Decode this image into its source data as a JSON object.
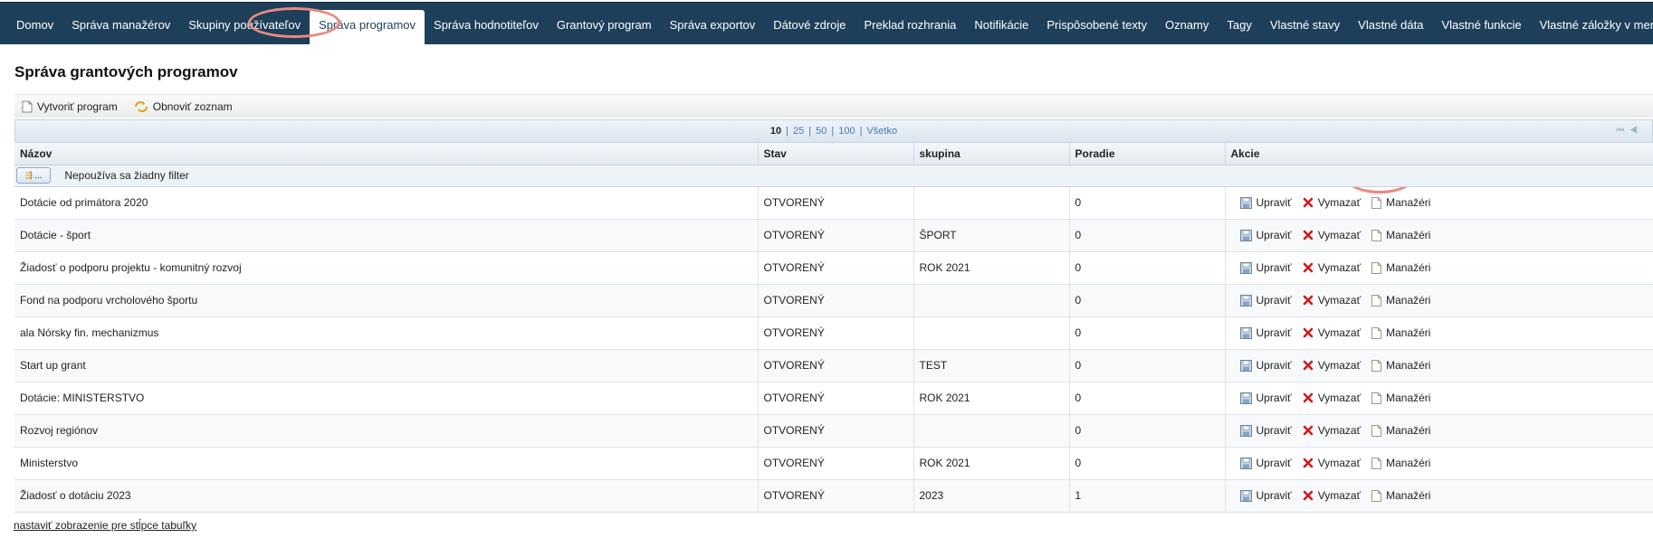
{
  "nav": {
    "items": [
      {
        "label": "Domov"
      },
      {
        "label": "Správa manažérov"
      },
      {
        "label": "Skupiny používateľov"
      },
      {
        "label": "Správa programov"
      },
      {
        "label": "Správa hodnotiteľov"
      },
      {
        "label": "Grantový program"
      },
      {
        "label": "Správa exportov"
      },
      {
        "label": "Dátové zdroje"
      },
      {
        "label": "Preklad rozhrania"
      },
      {
        "label": "Notifikácie"
      },
      {
        "label": "Prispôsobené texty"
      },
      {
        "label": "Oznamy"
      },
      {
        "label": "Tagy"
      },
      {
        "label": "Vlastné stavy"
      },
      {
        "label": "Vlastné dáta"
      },
      {
        "label": "Vlastné funkcie"
      },
      {
        "label": "Vlastné záložky v menu"
      }
    ],
    "active_index": 3
  },
  "page": {
    "title": "Správa grantových programov"
  },
  "toolbar": {
    "create_label": "Vytvoriť program",
    "refresh_label": "Obnoviť zoznam"
  },
  "pager": {
    "sizes": [
      "10",
      "25",
      "50",
      "100",
      "Všetko"
    ],
    "current": "10"
  },
  "table": {
    "headers": {
      "name": "Názov",
      "status": "Stav",
      "group": "skupina",
      "order": "Poradie",
      "actions": "Akcie"
    },
    "filter": {
      "button_label": "...",
      "text": "Nepoužíva sa žiadny filter"
    },
    "action_labels": {
      "edit": "Upraviť",
      "delete": "Vymazať",
      "managers": "Manažéri"
    },
    "rows": [
      {
        "name": "Dotácie od primátora 2020",
        "status": "OTVORENÝ",
        "group": "",
        "order": "0"
      },
      {
        "name": "Dotácie - šport",
        "status": "OTVORENÝ",
        "group": "ŠPORT",
        "order": "0"
      },
      {
        "name": "Žiadosť o podporu projektu - komunitný rozvoj",
        "status": "OTVORENÝ",
        "group": "ROK 2021",
        "order": "0"
      },
      {
        "name": "Fond na podporu vrcholového športu",
        "status": "OTVORENÝ",
        "group": "",
        "order": "0"
      },
      {
        "name": "ala Nórsky fin. mechanizmus",
        "status": "OTVORENÝ",
        "group": "",
        "order": "0"
      },
      {
        "name": "Start up grant",
        "status": "OTVORENÝ",
        "group": "TEST",
        "order": "0"
      },
      {
        "name": "Dotácie: MINISTERSTVO",
        "status": "OTVORENÝ",
        "group": "ROK 2021",
        "order": "0"
      },
      {
        "name": "Rozvoj regiónov",
        "status": "OTVORENÝ",
        "group": "",
        "order": "0"
      },
      {
        "name": "Ministerstvo",
        "status": "OTVORENÝ",
        "group": "ROK 2021",
        "order": "0"
      },
      {
        "name": "Žiadosť o dotáciu 2023",
        "status": "OTVORENÝ",
        "group": "2023",
        "order": "1"
      }
    ]
  },
  "footer": {
    "link_label": "nastaviť zobrazenie pre stĺpce tabuľky"
  },
  "colors": {
    "nav_bg": "#1e3f5a",
    "annotation": "#e88a80",
    "delete_red": "#d11a1a"
  }
}
